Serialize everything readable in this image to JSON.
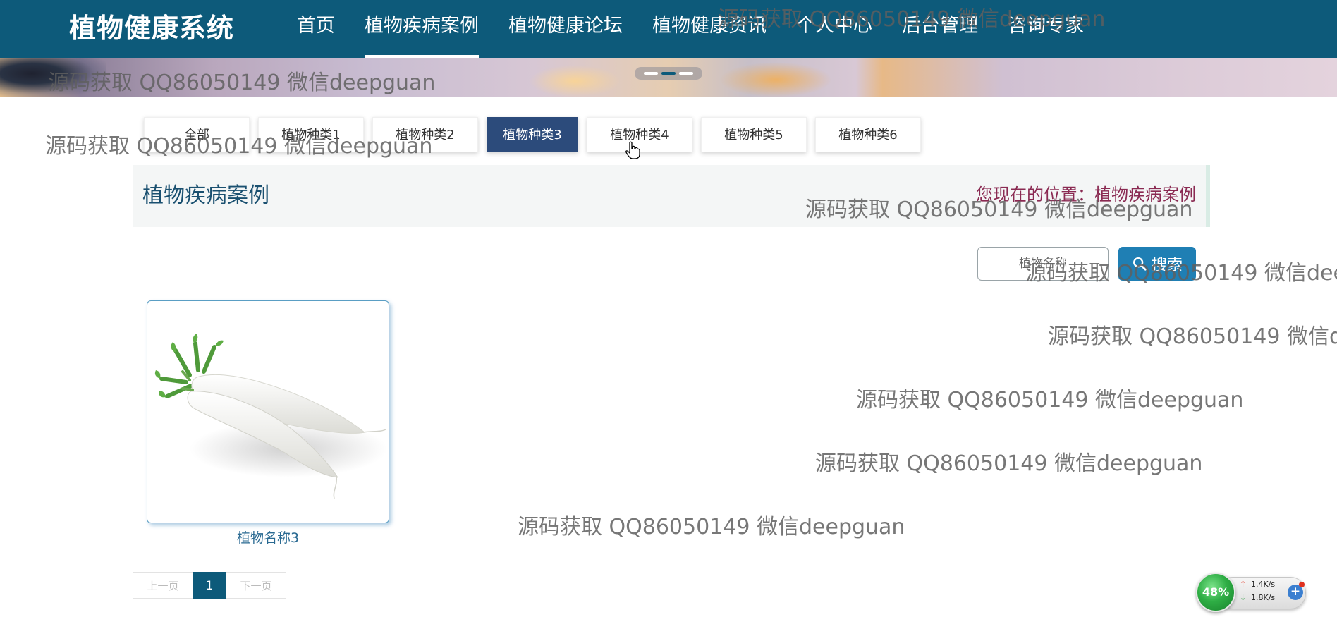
{
  "navbar": {
    "brand": "植物健康系统",
    "items": [
      {
        "label": "首页",
        "active": false
      },
      {
        "label": "植物疾病案例",
        "active": true
      },
      {
        "label": "植物健康论坛",
        "active": false
      },
      {
        "label": "植物健康资讯",
        "active": false
      },
      {
        "label": "个人中心",
        "active": false
      },
      {
        "label": "后台管理",
        "active": false
      },
      {
        "label": "咨询专家",
        "active": false
      }
    ]
  },
  "banner": {
    "slides": 3,
    "active_slide": 2
  },
  "tabs": [
    {
      "label": "全部",
      "active": false
    },
    {
      "label": "植物种类1",
      "active": false
    },
    {
      "label": "植物种类2",
      "active": false
    },
    {
      "label": "植物种类3",
      "active": true
    },
    {
      "label": "植物种类4",
      "active": false
    },
    {
      "label": "植物种类5",
      "active": false
    },
    {
      "label": "植物种类6",
      "active": false
    }
  ],
  "section": {
    "title": "植物疾病案例",
    "breadcrumb_prefix": "您现在的位置：",
    "breadcrumb_current": "植物疾病案例"
  },
  "search": {
    "placeholder": "植物名称",
    "button_label": "搜索"
  },
  "products": [
    {
      "name": "植物名称3",
      "image": "white-radish"
    }
  ],
  "pagination": {
    "prev_label": "上一页",
    "current": "1",
    "next_label": "下一页"
  },
  "watermark": {
    "texts": [
      "源码获取 QQ86050149 微信deepguan",
      "源码获取 QQ86050149 微信deepguan",
      "源码获取 QQ86050149 微信deepguan",
      "源码获取 QQ86050149 微信deepguan",
      "源码获取 QQ86050149 微信dee",
      "源码获取 QQ86050149 微信d",
      "源码获取 QQ86050149 微信deepguan",
      "源码获取 QQ86050149 微信deepguan",
      "源码获取 QQ86050149 微信deepguan"
    ]
  },
  "net_widget": {
    "percent": "48%",
    "upload": "1.4K/s",
    "download": "1.8K/s"
  },
  "colors": {
    "primary": "#0d5a7a",
    "tab_active": "#2c4b7b",
    "search_button": "#1f7fb4",
    "breadcrumb": "#8a2a52"
  }
}
